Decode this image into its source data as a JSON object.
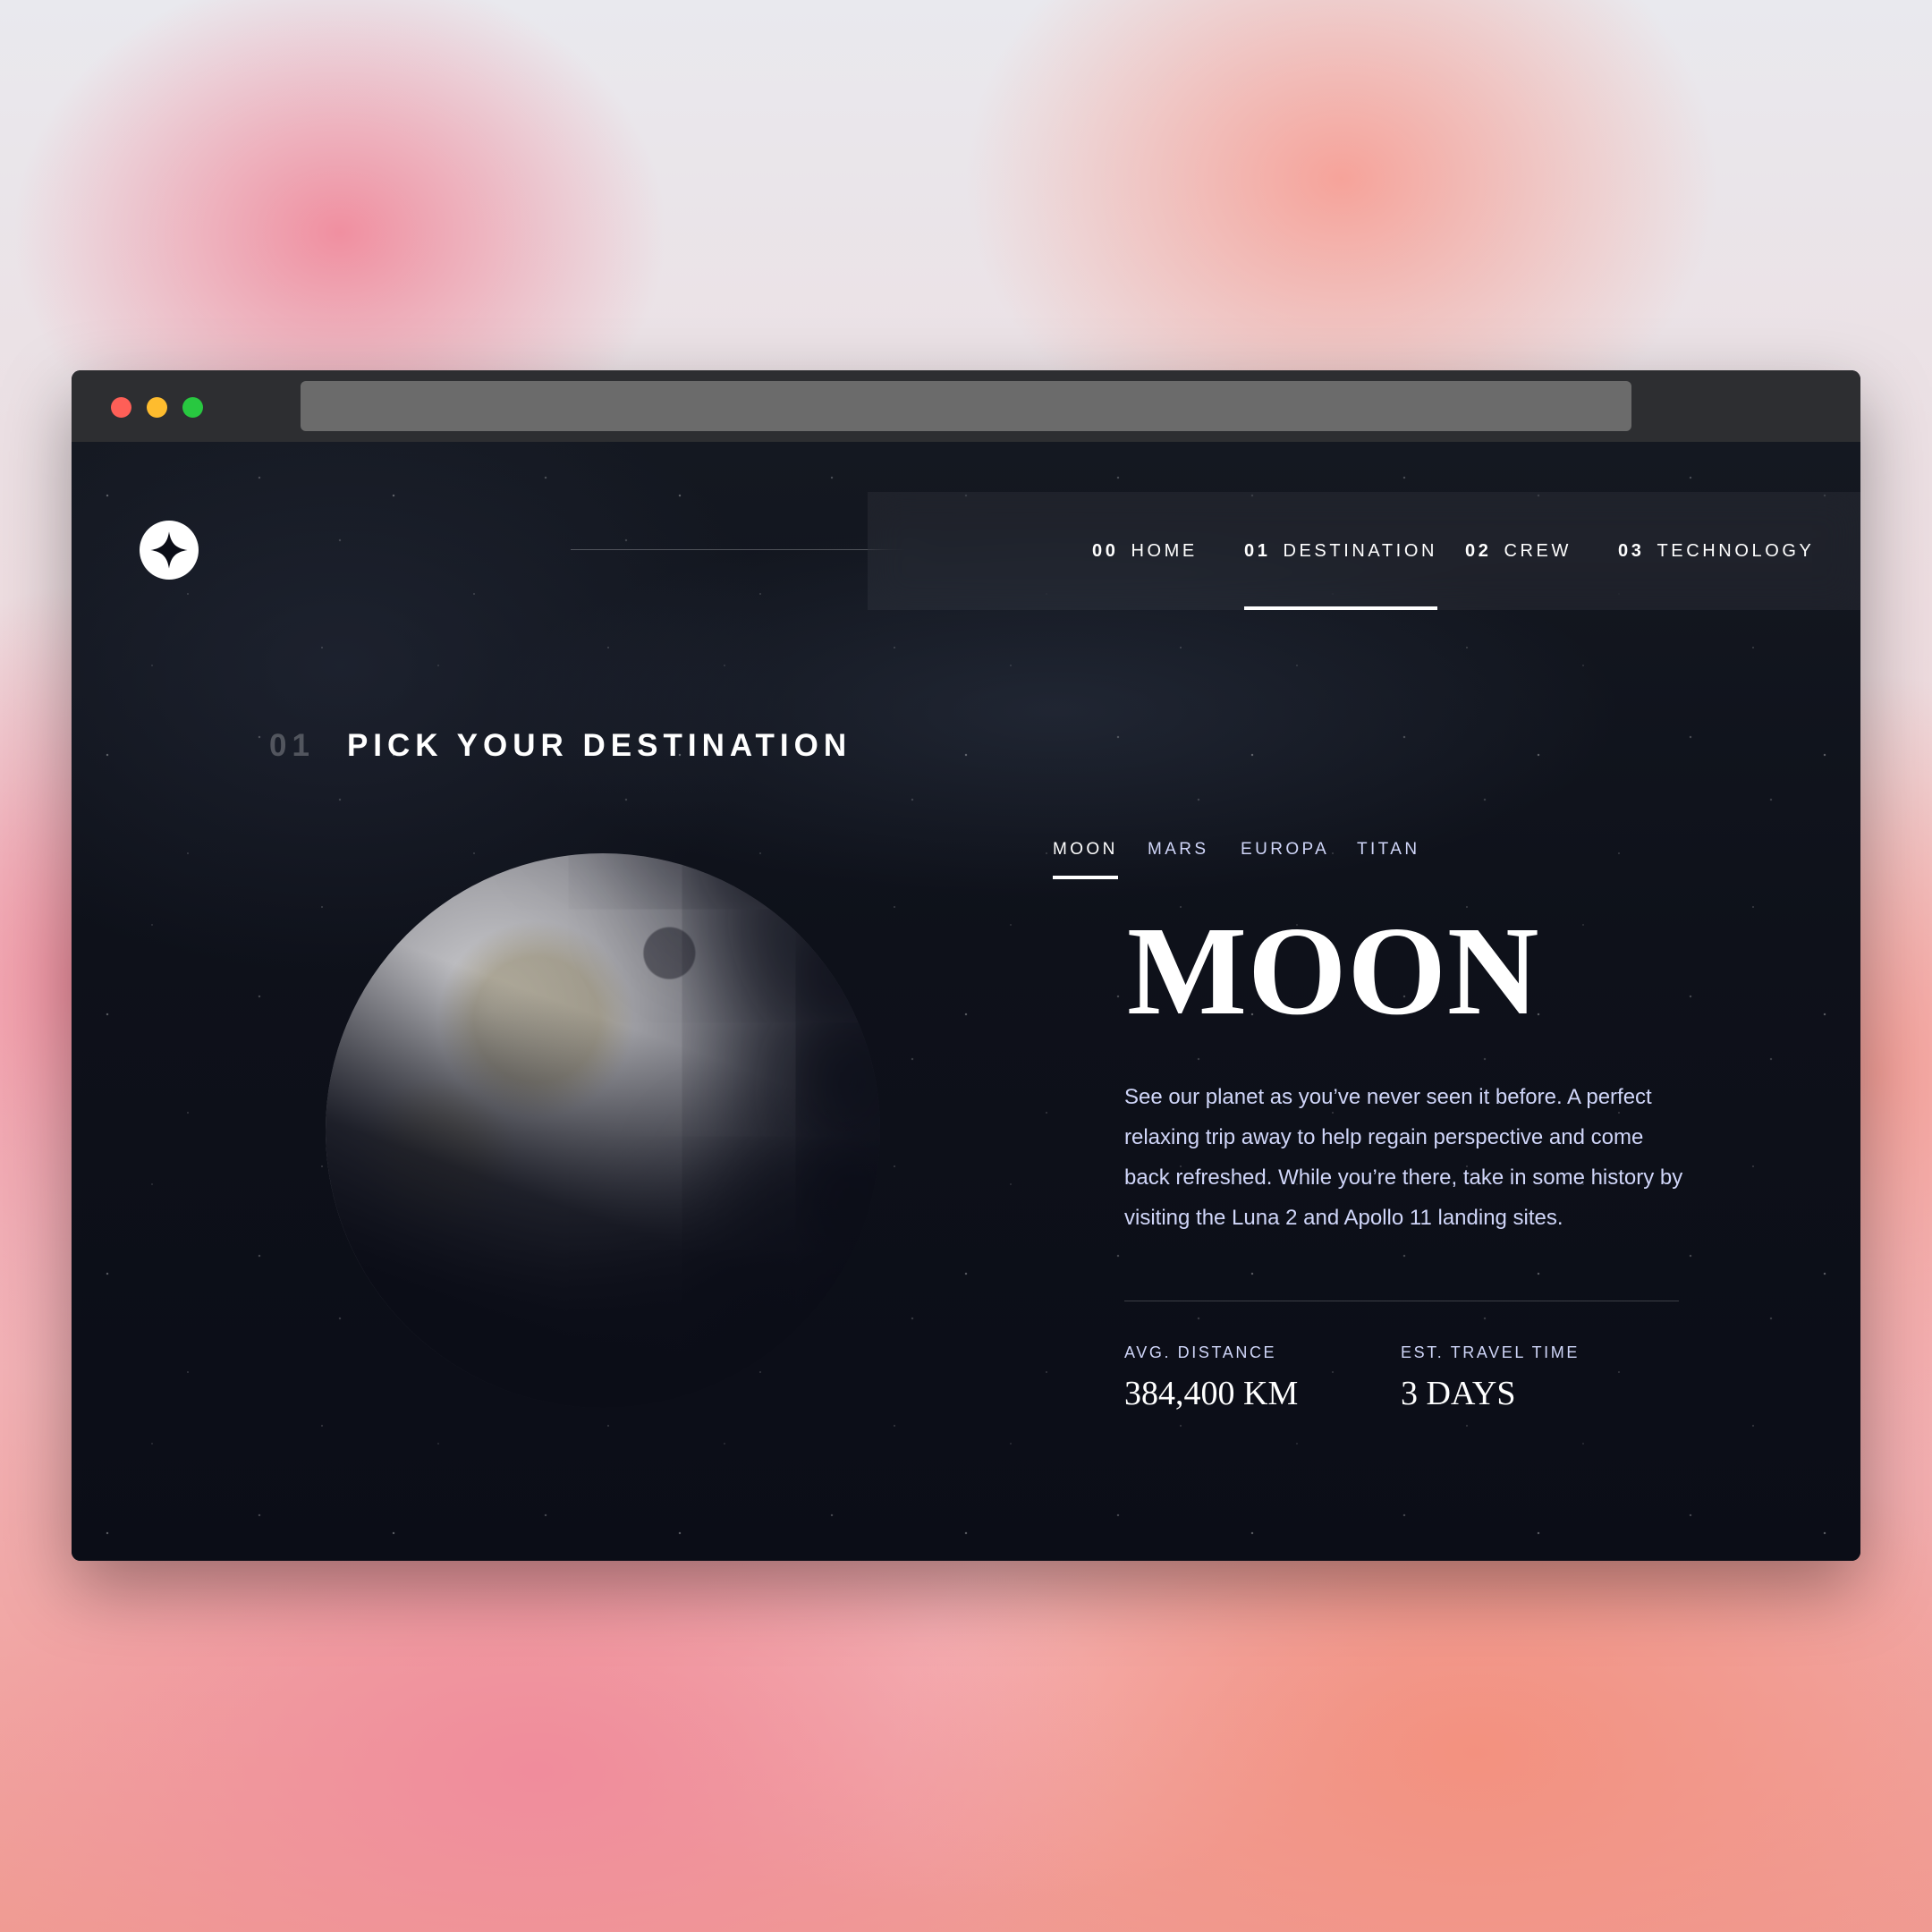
{
  "colors": {
    "page_bg": "#0b0d17",
    "text_primary": "#ffffff",
    "text_secondary": "#d0d6f9",
    "chrome_bg": "#2d2e31",
    "url_bar": "#6b6b6b",
    "traffic_red": "#fe5f57",
    "traffic_yellow": "#febc2e",
    "traffic_green": "#28c840"
  },
  "header": {
    "logo_icon": "four-point-star-icon",
    "nav": [
      {
        "num": "00",
        "label": "HOME",
        "active": false
      },
      {
        "num": "01",
        "label": "DESTINATION",
        "active": true
      },
      {
        "num": "02",
        "label": "CREW",
        "active": false
      },
      {
        "num": "03",
        "label": "TECHNOLOGY",
        "active": false
      }
    ]
  },
  "section": {
    "num": "01",
    "title": "PICK YOUR DESTINATION"
  },
  "destination": {
    "tabs": [
      {
        "label": "MOON",
        "active": true
      },
      {
        "label": "MARS",
        "active": false
      },
      {
        "label": "EUROPA",
        "active": false
      },
      {
        "label": "TITAN",
        "active": false
      }
    ],
    "name": "MOON",
    "description": "See our planet as you’ve never seen it before. A perfect relaxing trip away to help regain perspective and come back refreshed. While you’re there, take in some history by visiting the Luna 2 and Apollo 11 landing sites.",
    "stats": [
      {
        "label": "AVG. DISTANCE",
        "value": "384,400 KM"
      },
      {
        "label": "EST. TRAVEL TIME",
        "value": "3 DAYS"
      }
    ]
  }
}
